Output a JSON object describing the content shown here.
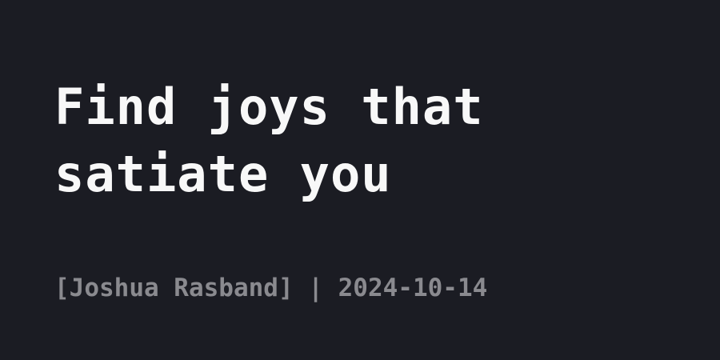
{
  "post": {
    "title": "Find joys that satiate you",
    "author_bracketed": "[Joshua Rasband]",
    "separator": "|",
    "date": "2024-10-14"
  },
  "colors": {
    "background": "#1b1c23",
    "title_text": "#f8f8f8",
    "meta_text": "#8a8a8f"
  }
}
